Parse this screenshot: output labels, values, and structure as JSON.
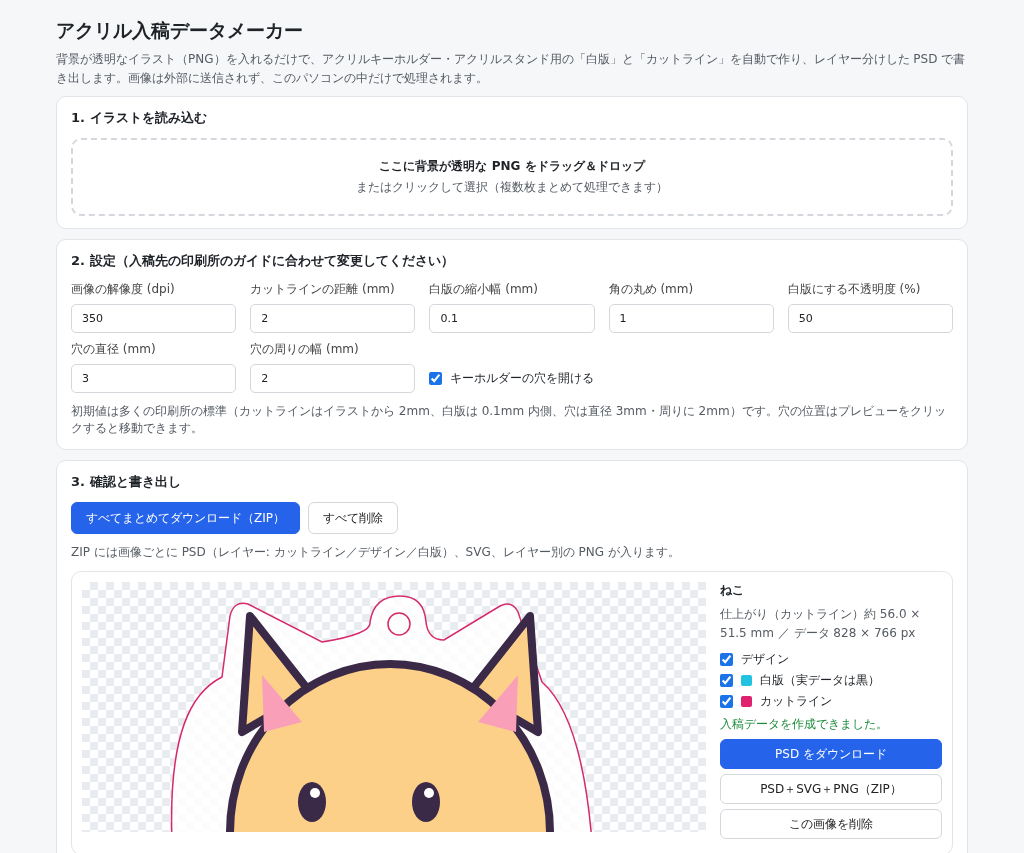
{
  "title": "アクリル入稿データメーカー",
  "description": "背景が透明なイラスト（PNG）を入れるだけで、アクリルキーホルダー・アクリルスタンド用の「白版」と「カットライン」を自動で作り、レイヤー分けした PSD で書き出します。画像は外部に送信されず、このパソコンの中だけで処理されます。",
  "upload": {
    "heading": "1. イラストを読み込む",
    "drop_title": "ここに背景が透明な PNG をドラッグ＆ドロップ",
    "drop_hint": "またはクリックして選択（複数枚まとめて処理できます）"
  },
  "settings": {
    "heading": "2. 設定（入稿先の印刷所のガイドに合わせて変更してください）",
    "fields": [
      {
        "label": "画像の解像度 (dpi)",
        "value": "350"
      },
      {
        "label": "カットラインの距離 (mm)",
        "value": "2"
      },
      {
        "label": "白版の縮小幅 (mm)",
        "value": "0.1"
      },
      {
        "label": "角の丸め (mm)",
        "value": "1"
      },
      {
        "label": "白版にする不透明度 (%)",
        "value": "50"
      },
      {
        "label": "穴の直径 (mm)",
        "value": "3"
      },
      {
        "label": "穴の周りの幅 (mm)",
        "value": "2"
      }
    ],
    "hole_option": {
      "label": "キーホルダーの穴を開ける",
      "checked": true
    },
    "note": "初期値は多くの印刷所の標準（カットラインはイラストから 2mm、白版は 0.1mm 内側、穴は直径 3mm・周りに 2mm）です。穴の位置はプレビューをクリックすると移動できます。"
  },
  "export": {
    "heading": "3. 確認と書き出し",
    "buttons": [
      {
        "label": "すべてまとめてダウンロード（ZIP）",
        "kind": "primary"
      },
      {
        "label": "すべて削除",
        "kind": "secondary"
      }
    ],
    "note": "ZIP には画像ごとに PSD（レイヤー: カットライン／デザイン／白版）、SVG、レイヤー別の PNG が入ります。",
    "items": [
      {
        "name": "ねこ",
        "size_info": "仕上がり（カットライン）約 56.0 × 51.5 mm ／ データ 828 × 766 px",
        "layers": [
          {
            "label": "デザイン",
            "checked": true
          },
          {
            "label": "白版（実データは黒）",
            "checked": true,
            "color": "#22c3e0"
          },
          {
            "label": "カットライン",
            "checked": true,
            "color": "#e0216e"
          }
        ],
        "status": "入稿データを作成できました。",
        "actions": [
          {
            "label": "PSD をダウンロード",
            "kind": "primary"
          },
          {
            "label": "PSD＋SVG＋PNG（ZIP）",
            "kind": "secondary"
          },
          {
            "label": "この画像を削除",
            "kind": "secondary"
          }
        ]
      }
    ]
  }
}
